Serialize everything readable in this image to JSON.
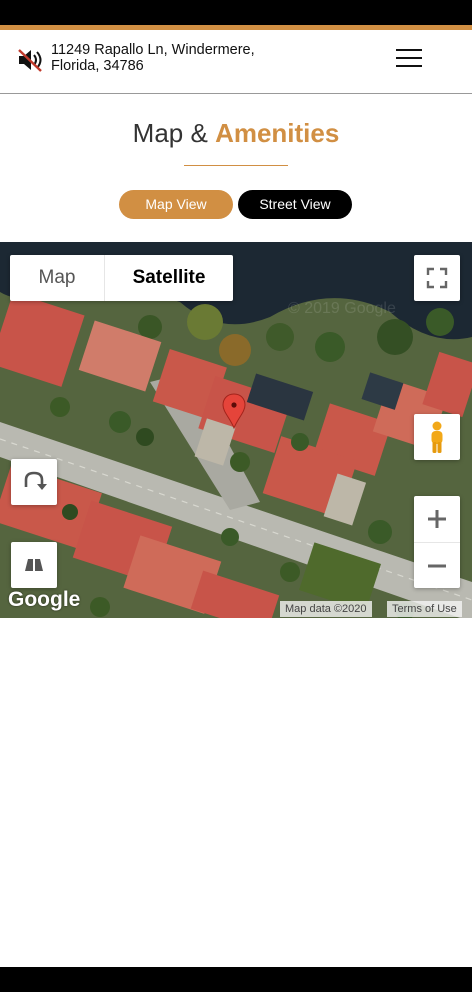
{
  "header": {
    "address_line1": "11249 Rapallo Ln, Windermere,",
    "address_line2": "Florida, 34786",
    "speaker_icon": "speaker-muted-icon",
    "menu_icon": "hamburger-menu-icon"
  },
  "section": {
    "title_prefix": "Map &",
    "title_highlight": "Amenities"
  },
  "view_buttons": {
    "map_view": "Map View",
    "street_view": "Street View"
  },
  "map": {
    "type_options": [
      "Map",
      "Satellite"
    ],
    "selected_type": "Satellite",
    "watermark": "© 2019 Google",
    "logo": "Google",
    "attribution": "Map data ©2020",
    "terms": "Terms of Use",
    "icons": {
      "fullscreen": "fullscreen-icon",
      "pegman": "street-view-pegman-icon",
      "rotate": "rotate-map-icon",
      "tilt": "tilt-map-icon",
      "zoom_in": "zoom-in-icon",
      "zoom_out": "zoom-out-icon",
      "marker": "map-marker-icon"
    }
  },
  "colors": {
    "accent": "#d18f43",
    "dark": "#000000",
    "roof": "#c9584a",
    "water": "#1e2a36",
    "foliage": "#4a6b2e",
    "road": "#b5b5ae"
  }
}
